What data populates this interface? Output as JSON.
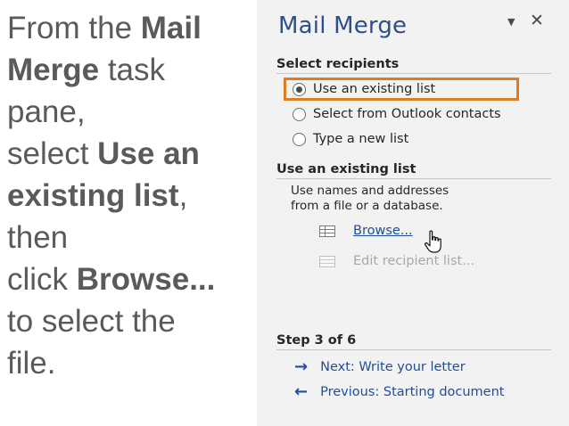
{
  "slide": {
    "line1_pre": "From the ",
    "line1_bold": "Mail",
    "line2_bold": "Merge",
    "line2_post": " task",
    "line3": "pane,",
    "line4_pre": "select ",
    "line4_bold": "Use an",
    "line5_bold": "existing list",
    "line5_post": ",",
    "line6": "then",
    "line7_pre": "click ",
    "line7_bold": "Browse...",
    "line8": "to select the",
    "line9": "file."
  },
  "pane": {
    "title": "Mail Merge",
    "menu_icon": "dropdown-arrow-icon",
    "close_icon": "close-icon",
    "accent_color": "#e07b22",
    "select_recipients": {
      "heading": "Select recipients",
      "options": [
        {
          "label": "Use an existing list",
          "checked": true
        },
        {
          "label": "Select from Outlook contacts",
          "checked": false
        },
        {
          "label": "Type a new list",
          "checked": false
        }
      ]
    },
    "existing_list": {
      "heading": "Use an existing list",
      "desc_line1": "Use names and addresses",
      "desc_line2": "from a file or a database.",
      "browse_label": "Browse...",
      "edit_label": "Edit recipient list..."
    },
    "step": {
      "heading": "Step 3 of 6",
      "next_label": "Next: Write your letter",
      "previous_label": "Previous: Starting document"
    }
  }
}
